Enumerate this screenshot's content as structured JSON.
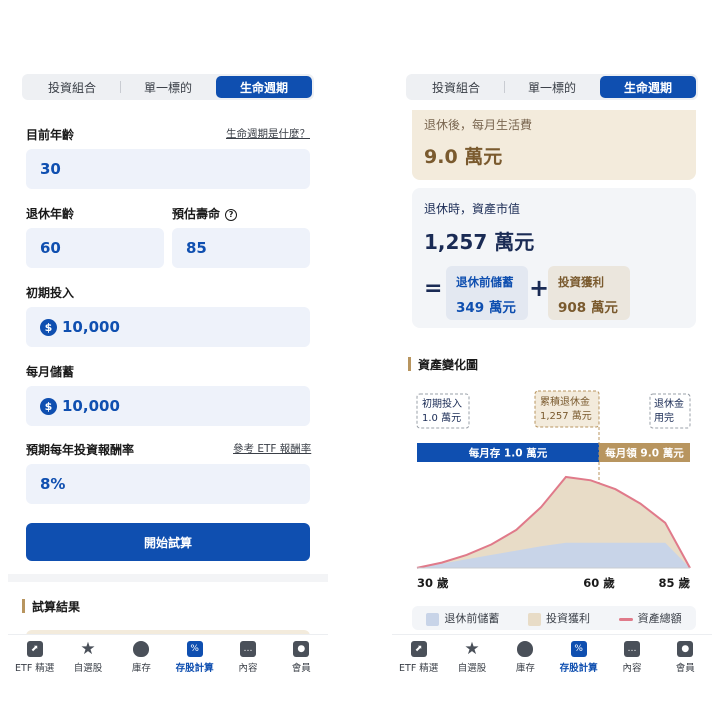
{
  "tabs": [
    "投資組合",
    "單一標的",
    "生命週期"
  ],
  "form": {
    "current_age_label": "目前年齡",
    "lifecycle_help": "生命週期是什麼？",
    "current_age_value": "30",
    "retire_age_label": "退休年齡",
    "life_expectancy_label": "預估壽命",
    "retire_age_value": "60",
    "life_expectancy_value": "85",
    "initial_invest_label": "初期投入",
    "initial_invest_value": "10,000",
    "monthly_saving_label": "每月儲蓄",
    "monthly_saving_value": "10,000",
    "return_rate_label": "預期每年投資報酬率",
    "etf_ref_link": "參考 ETF 報酬率",
    "return_rate_value": "8%",
    "start_button": "開始試算",
    "result_title": "試算結果",
    "currency_symbol": "$",
    "help_symbol": "?"
  },
  "results": {
    "living_label": "退休後，每月生活費",
    "living_value": "9.0 萬元",
    "asset_label": "退休時，資產市值",
    "asset_value": "1,257 萬元",
    "equals": "=",
    "plus": "+",
    "savings_label": "退休前儲蓄",
    "savings_value": "349 萬元",
    "gain_label": "投資獲利",
    "gain_value": "908 萬元",
    "chart_title": "資產變化圖"
  },
  "chart": {
    "annotation_initial_l1": "初期投入",
    "annotation_initial_l2": "1.0 萬元",
    "annotation_accum_l1": "累積退休金",
    "annotation_accum_l2": "1,257 萬元",
    "annotation_depleted_l1": "退休金",
    "annotation_depleted_l2": "用完",
    "phase_save": "每月存 1.0 萬元",
    "phase_draw": "每月領 9.0 萬元",
    "x_tick_start": "30 歲",
    "x_tick_retire": "60 歲",
    "x_tick_end": "85 歲",
    "legend_savings": "退休前儲蓄",
    "legend_gain": "投資獲利",
    "legend_total": "資產總額"
  },
  "nav": [
    {
      "label": "ETF 精選"
    },
    {
      "label": "自選股"
    },
    {
      "label": "庫存"
    },
    {
      "label": "存股計算"
    },
    {
      "label": "內容"
    },
    {
      "label": "會員"
    }
  ],
  "colors": {
    "brand_blue": "#0f4fb0",
    "gold": "#b8955f",
    "savings_fill": "#c8d4e8",
    "gain_fill": "#e8dcc7",
    "total_line": "#e07a8a"
  },
  "chart_data": {
    "type": "area",
    "x": [
      30,
      35,
      40,
      45,
      50,
      55,
      60,
      65,
      70,
      75,
      80,
      85
    ],
    "x_ticks": [
      "30 歲",
      "60 歲",
      "85 歲"
    ],
    "series": [
      {
        "name": "退休前儲蓄",
        "values": [
          1,
          61,
          121,
          181,
          241,
          301,
          349,
          349,
          349,
          349,
          349,
          349
        ]
      },
      {
        "name": "投資獲利",
        "values": [
          0,
          14,
          60,
          145,
          285,
          540,
          908,
          862,
          740,
          540,
          275,
          0
        ]
      },
      {
        "name": "資產總額",
        "values": [
          1,
          75,
          181,
          326,
          526,
          841,
          1257,
          1211,
          1089,
          889,
          624,
          0
        ]
      }
    ],
    "ylim": [
      0,
      1400
    ],
    "legend_position": "bottom"
  }
}
